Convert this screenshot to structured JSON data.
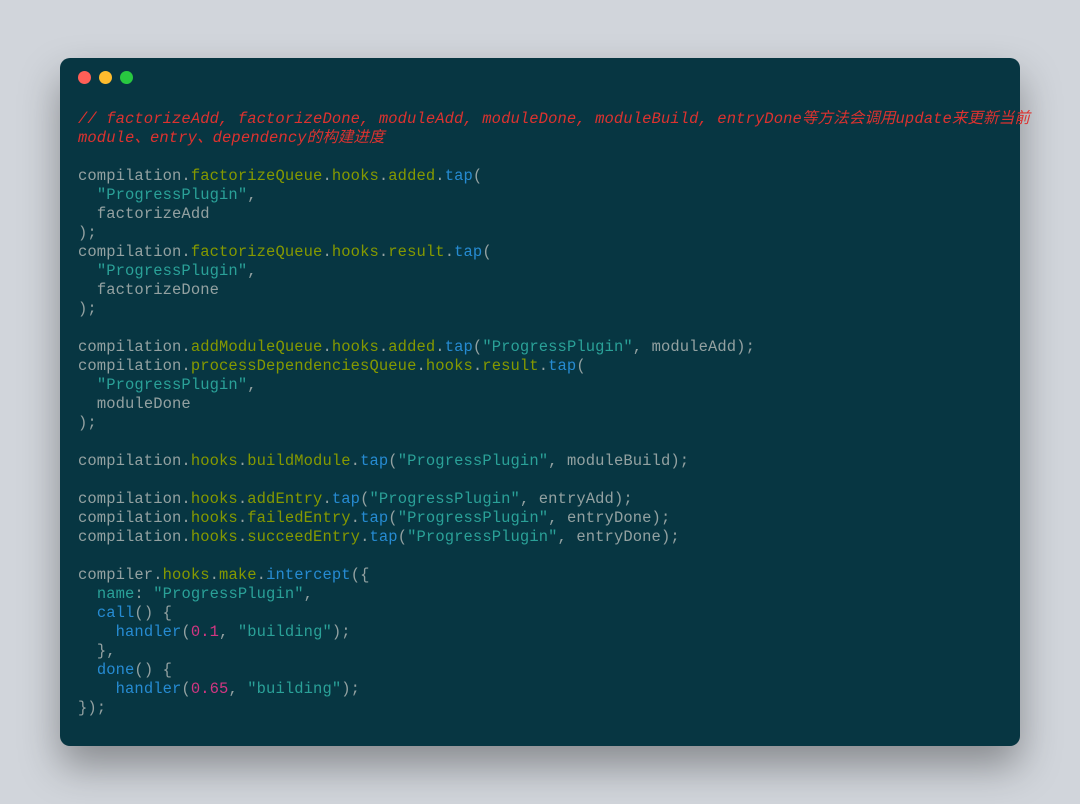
{
  "window": {
    "traffic_lights": [
      "close",
      "minimize",
      "zoom"
    ]
  },
  "colors": {
    "bg_page": "#d1d5db",
    "bg_window": "#073642",
    "comment": "#dc322f",
    "string": "#2aa198",
    "number": "#d33682",
    "property": "#859900",
    "keyword": "#268bd2",
    "default": "#93a1a1"
  },
  "code": {
    "comment": "// factorizeAdd, factorizeDone, moduleAdd, moduleDone, moduleBuild, entryDone等方法会调用update来更新当前module、entry、dependency的构建进度",
    "lines": {
      "l1_pre": "compilation.",
      "l1_p1": "factorizeQueue",
      "l1_dot1": ".",
      "l1_p2": "hooks",
      "l1_dot2": ".",
      "l1_p3": "added",
      "l1_dot3": ".",
      "l1_fn": "tap",
      "l1_post": "(",
      "l2_indent": "  ",
      "l2_str": "\"ProgressPlugin\"",
      "l2_post": ",",
      "l3_indent": "  ",
      "l3_id": "factorizeAdd",
      "l4": ");",
      "l5_pre": "compilation.",
      "l5_p1": "factorizeQueue",
      "l5_dot1": ".",
      "l5_p2": "hooks",
      "l5_dot2": ".",
      "l5_p3": "result",
      "l5_dot3": ".",
      "l5_fn": "tap",
      "l5_post": "(",
      "l6_indent": "  ",
      "l6_str": "\"ProgressPlugin\"",
      "l6_post": ",",
      "l7_indent": "  ",
      "l7_id": "factorizeDone",
      "l8": ");",
      "l10_pre": "compilation.",
      "l10_p1": "addModuleQueue",
      "l10_dot1": ".",
      "l10_p2": "hooks",
      "l10_dot2": ".",
      "l10_p3": "added",
      "l10_dot3": ".",
      "l10_fn": "tap",
      "l10_post1": "(",
      "l10_str": "\"ProgressPlugin\"",
      "l10_post2": ", moduleAdd);",
      "l11_pre": "compilation.",
      "l11_p1": "processDependenciesQueue",
      "l11_dot1": ".",
      "l11_p2": "hooks",
      "l11_dot2": ".",
      "l11_p3": "result",
      "l11_dot3": ".",
      "l11_fn": "tap",
      "l11_post": "(",
      "l12_indent": "  ",
      "l12_str": "\"ProgressPlugin\"",
      "l12_post": ",",
      "l13_indent": "  ",
      "l13_id": "moduleDone",
      "l14": ");",
      "l16_pre": "compilation.",
      "l16_p1": "hooks",
      "l16_dot1": ".",
      "l16_p2": "buildModule",
      "l16_dot2": ".",
      "l16_fn": "tap",
      "l16_post1": "(",
      "l16_str": "\"ProgressPlugin\"",
      "l16_post2": ", moduleBuild);",
      "l18_pre": "compilation.",
      "l18_p1": "hooks",
      "l18_dot1": ".",
      "l18_p2": "addEntry",
      "l18_dot2": ".",
      "l18_fn": "tap",
      "l18_post1": "(",
      "l18_str": "\"ProgressPlugin\"",
      "l18_post2": ", entryAdd);",
      "l19_pre": "compilation.",
      "l19_p1": "hooks",
      "l19_dot1": ".",
      "l19_p2": "failedEntry",
      "l19_dot2": ".",
      "l19_fn": "tap",
      "l19_post1": "(",
      "l19_str": "\"ProgressPlugin\"",
      "l19_post2": ", entryDone);",
      "l20_pre": "compilation.",
      "l20_p1": "hooks",
      "l20_dot1": ".",
      "l20_p2": "succeedEntry",
      "l20_dot2": ".",
      "l20_fn": "tap",
      "l20_post1": "(",
      "l20_str": "\"ProgressPlugin\"",
      "l20_post2": ", entryDone);",
      "l22_pre": "compiler.",
      "l22_p1": "hooks",
      "l22_dot1": ".",
      "l22_p2": "make",
      "l22_dot2": ".",
      "l22_fn": "intercept",
      "l22_post": "({",
      "l23_indent": "  ",
      "l23_key": "name",
      "l23_sep": ": ",
      "l23_str": "\"ProgressPlugin\"",
      "l23_post": ",",
      "l24_indent": "  ",
      "l24_fn": "call",
      "l24_post": "() {",
      "l25_indent": "    ",
      "l25_fn": "handler",
      "l25_post1": "(",
      "l25_num": "0.1",
      "l25_post2": ", ",
      "l25_str": "\"building\"",
      "l25_post3": ");",
      "l26_indent": "  ",
      "l26": "},",
      "l27_indent": "  ",
      "l27_fn": "done",
      "l27_post": "() {",
      "l28_indent": "    ",
      "l28_fn": "handler",
      "l28_post1": "(",
      "l28_num": "0.65",
      "l28_post2": ", ",
      "l28_str": "\"building\"",
      "l28_post3": ");",
      "l29": "});"
    }
  }
}
